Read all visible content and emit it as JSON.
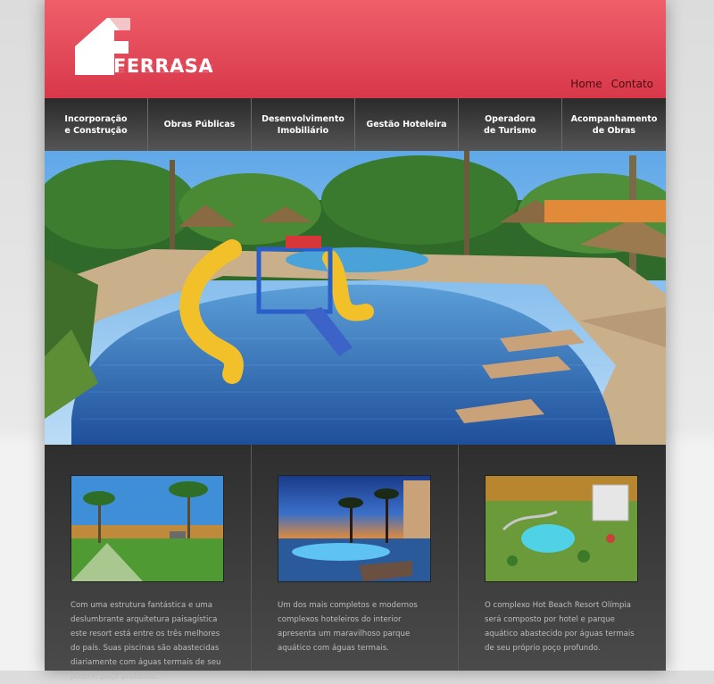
{
  "header": {
    "logo_text": "FERRASA",
    "links": [
      {
        "label": "Home"
      },
      {
        "label": "Contato"
      }
    ]
  },
  "nav": {
    "items": [
      {
        "label": "Incorporação\ne Construção"
      },
      {
        "label": "Obras Públicas"
      },
      {
        "label": "Desenvolvimento\nImobiliário"
      },
      {
        "label": "Gestão Hoteleira"
      },
      {
        "label": "Operadora\nde Turismo"
      },
      {
        "label": "Acompanhamento\nde Obras"
      }
    ]
  },
  "features": [
    {
      "text": "Com uma estrutura fantástica e uma deslumbrante arquitetura paisagística este resort está entre os três melhores do país. Suas piscinas são abastecidas diariamente com águas termais de seu próprio poço profundo."
    },
    {
      "text": "Um dos mais completos e modernos complexos hoteleiros do interior apresenta um maravilhoso parque aquático com águas termais."
    },
    {
      "text": "O complexo Hot Beach Resort Olímpia será composto por hotel e parque aquático abastecido por águas termais de seu próprio poço profundo."
    }
  ],
  "colors": {
    "header_red": "#d8384a",
    "nav_dark": "#2a2a2a",
    "body_dark": "#3a3a3a"
  }
}
